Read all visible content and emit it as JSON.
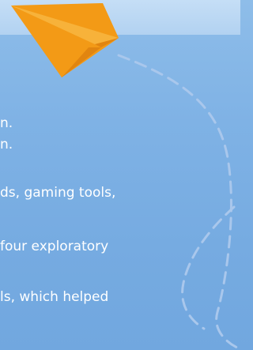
{
  "slide": {
    "lines": [
      "n.",
      "n.",
      "ds, gaming tools,",
      "four exploratory",
      "ls, which helped"
    ]
  }
}
